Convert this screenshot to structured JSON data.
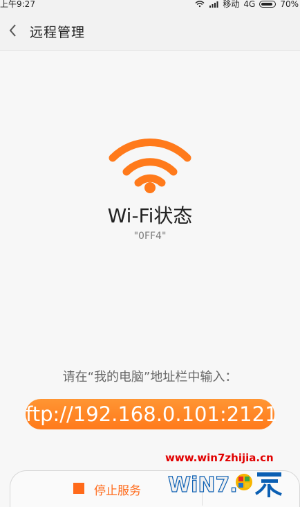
{
  "status_bar": {
    "time": "上午9:27",
    "carrier": "移动",
    "network": "4G",
    "battery": "70%"
  },
  "header": {
    "title": "远程管理"
  },
  "main": {
    "wifi_status_label": "Wi-Fi状态",
    "ssid": "\"0FF4\"",
    "instruction": "请在“我的电脑”地址栏中输入：",
    "ftp_address": "ftp://192.168.0.101:2121"
  },
  "footer": {
    "stop_label": "停止服务"
  },
  "watermark": {
    "url": "www.win7zhijia.cn"
  },
  "colors": {
    "accent": "#ff7a1b",
    "stop": "#ff6a1a"
  }
}
